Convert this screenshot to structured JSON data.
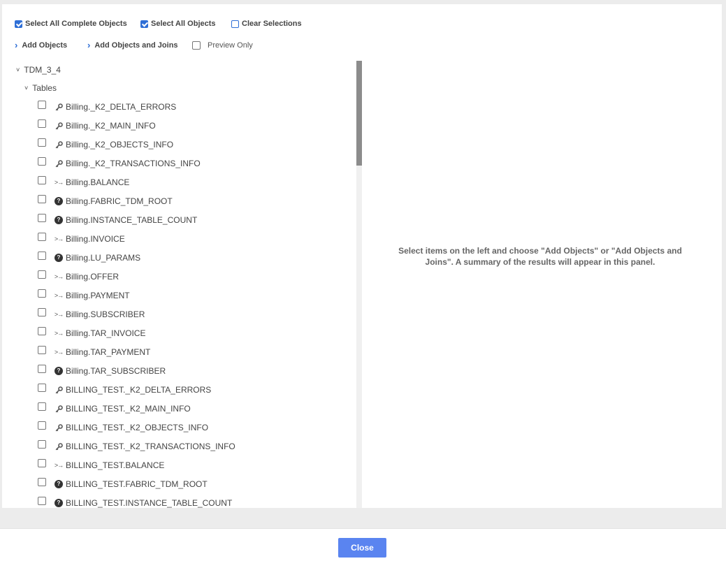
{
  "toolbar": {
    "select_all_complete_label": "Select All Complete Objects",
    "select_all_objects_label": "Select All Objects",
    "clear_selections_label": "Clear Selections",
    "add_objects_label": "Add Objects",
    "add_objects_joins_label": "Add Objects and Joins",
    "preview_only_label": "Preview Only"
  },
  "tree": {
    "root_label": "TDM_3_4",
    "group_label": "Tables",
    "items": [
      {
        "label": "Billing._K2_DELTA_ERRORS",
        "icon": "key-icon"
      },
      {
        "label": "Billing._K2_MAIN_INFO",
        "icon": "key-icon"
      },
      {
        "label": "Billing._K2_OBJECTS_INFO",
        "icon": "key-icon"
      },
      {
        "label": "Billing._K2_TRANSACTIONS_INFO",
        "icon": "key-icon"
      },
      {
        "label": "Billing.BALANCE",
        "icon": "join-icon"
      },
      {
        "label": "Billing.FABRIC_TDM_ROOT",
        "icon": "help-icon"
      },
      {
        "label": "Billing.INSTANCE_TABLE_COUNT",
        "icon": "help-icon"
      },
      {
        "label": "Billing.INVOICE",
        "icon": "join-icon"
      },
      {
        "label": "Billing.LU_PARAMS",
        "icon": "help-icon"
      },
      {
        "label": "Billing.OFFER",
        "icon": "join-icon"
      },
      {
        "label": "Billing.PAYMENT",
        "icon": "join-icon"
      },
      {
        "label": "Billing.SUBSCRIBER",
        "icon": "join-icon"
      },
      {
        "label": "Billing.TAR_INVOICE",
        "icon": "join-icon"
      },
      {
        "label": "Billing.TAR_PAYMENT",
        "icon": "join-icon"
      },
      {
        "label": "Billing.TAR_SUBSCRIBER",
        "icon": "help-icon"
      },
      {
        "label": "BILLING_TEST._K2_DELTA_ERRORS",
        "icon": "key-icon"
      },
      {
        "label": "BILLING_TEST._K2_MAIN_INFO",
        "icon": "key-icon"
      },
      {
        "label": "BILLING_TEST._K2_OBJECTS_INFO",
        "icon": "key-icon"
      },
      {
        "label": "BILLING_TEST._K2_TRANSACTIONS_INFO",
        "icon": "key-icon"
      },
      {
        "label": "BILLING_TEST.BALANCE",
        "icon": "join-icon"
      },
      {
        "label": "BILLING_TEST.FABRIC_TDM_ROOT",
        "icon": "help-icon"
      },
      {
        "label": "BILLING_TEST.INSTANCE_TABLE_COUNT",
        "icon": "help-icon"
      }
    ]
  },
  "summary_panel": {
    "empty_message": "Select items on the left and choose \"Add Objects\" or \"Add Objects and Joins\". A summary of the results will appear in this panel."
  },
  "footer": {
    "close_label": "Close"
  },
  "colors": {
    "accent": "#2f6fd6",
    "close_button": "#5a84f0"
  }
}
